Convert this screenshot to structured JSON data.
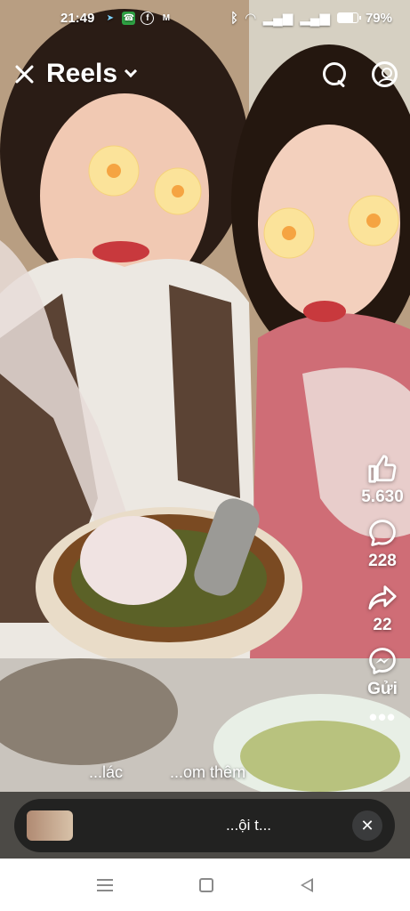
{
  "status_bar": {
    "time": "21:49",
    "battery": "79%",
    "battery_level": 0.79,
    "app_icons": [
      "navigation-icon",
      "phone-icon",
      "facebook-icon",
      "gmail-icon"
    ]
  },
  "top_nav": {
    "title": "Reels",
    "icons": [
      "close-icon",
      "chevron-down-icon",
      "search-icon",
      "profile-icon"
    ]
  },
  "actions": {
    "like_count": "5.630",
    "comment_count": "228",
    "share_count": "22",
    "send_label": "Gửi"
  },
  "caption": {
    "part1": "...lác",
    "part2": "...om thêm"
  },
  "suggestion": {
    "text": "...ội t..."
  },
  "colors": {
    "overlay": "#1e1e1e",
    "close_button": "#3a3b3c",
    "nav_bar": "#ffffff",
    "nav_icon": "#8a8a8a"
  }
}
